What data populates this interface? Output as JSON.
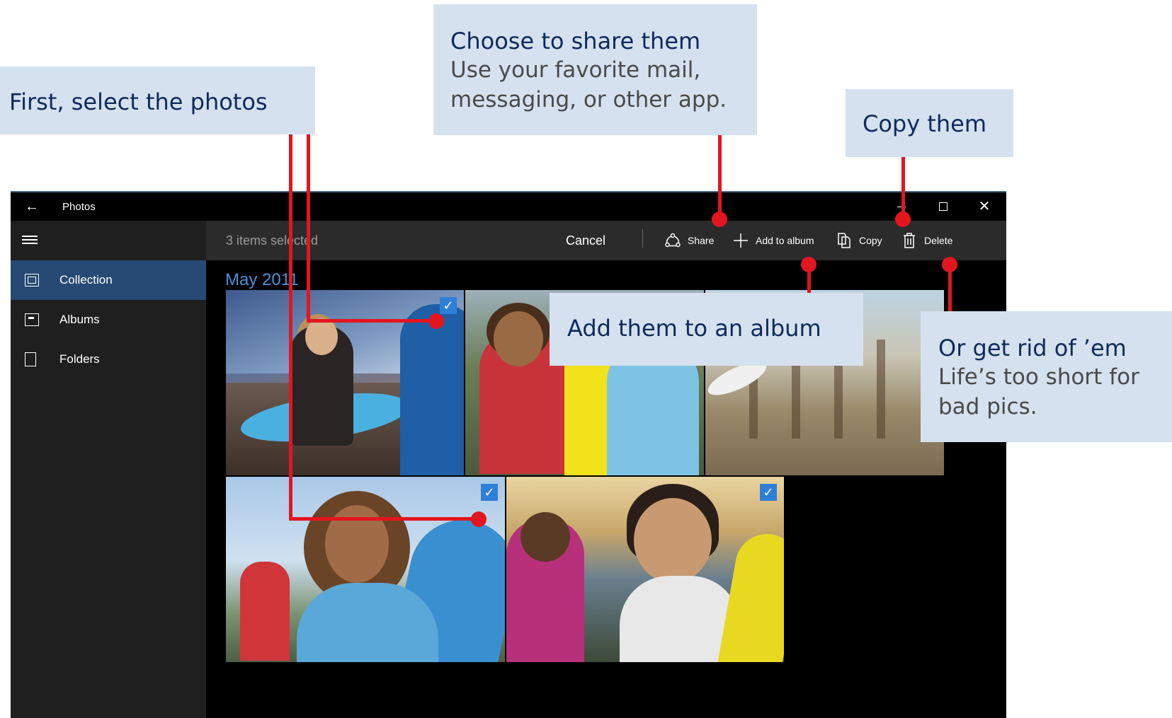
{
  "window": {
    "title": "Photos",
    "back_icon": "←",
    "close_glyph": "✕"
  },
  "sidebar": {
    "items": [
      {
        "label": "Collection",
        "icon": "collection-icon",
        "active": true
      },
      {
        "label": "Albums",
        "icon": "albums-icon",
        "active": false
      },
      {
        "label": "Folders",
        "icon": "folders-icon",
        "active": false
      }
    ]
  },
  "command_bar": {
    "selection_count": "3 items selected",
    "cancel": "Cancel",
    "share": "Share",
    "add_to_album": "Add to album",
    "copy": "Copy",
    "delete": "Delete"
  },
  "content": {
    "month": "May 2011",
    "check_glyph": "✓"
  },
  "callouts": {
    "select": {
      "head": "First, select the photos"
    },
    "share": {
      "head": "Choose to share them",
      "sub": "Use your favorite mail, messaging, or other app."
    },
    "copy": {
      "head": "Copy them"
    },
    "album": {
      "head": "Add them to an album"
    },
    "delete": {
      "head": "Or get rid of ’em",
      "sub": "Life’s too short for bad pics."
    }
  },
  "colors": {
    "accent": "#3a87e0",
    "callout_bg": "#d6e1ef",
    "callout_text": "#0f2a5a",
    "connector": "#e3151f",
    "active_nav": "#264a73"
  }
}
